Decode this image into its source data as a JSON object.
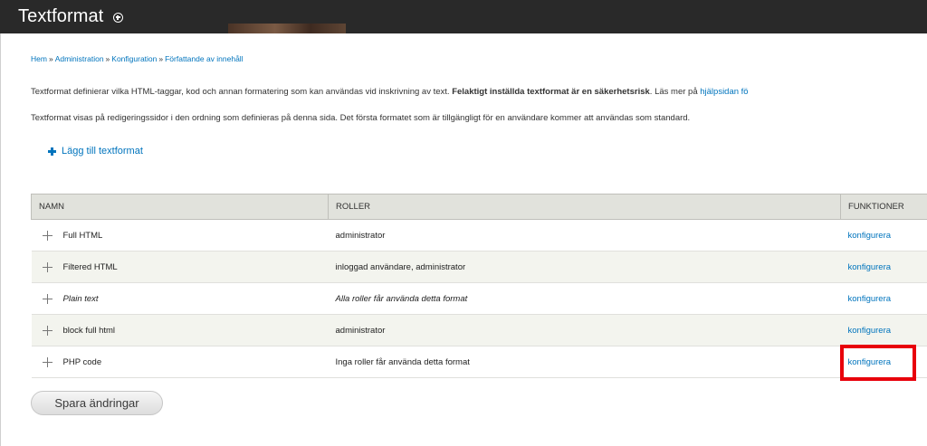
{
  "header": {
    "title": "Textformat",
    "shortcut_icon": "add-shortcut-icon"
  },
  "breadcrumb": {
    "items": [
      "Hem",
      "Administration",
      "Konfiguration",
      "Författande av innehåll"
    ],
    "separator": "»"
  },
  "help": {
    "line1_start": "Textformat definierar vilka HTML-taggar, kod och annan formatering som kan användas vid inskrivning av text. ",
    "line1_bold": "Felaktigt inställda textformat är en säkerhetsrisk",
    "line1_end": ". Läs mer på ",
    "line1_link": "hjälpsidan fö",
    "line2": "Textformat visas på redigeringssidor i den ordning som definieras på denna sida. Det första formatet som är tillgängligt för en användare kommer att användas som standard."
  },
  "add_link": {
    "label": "Lägg till textformat",
    "icon": "plus-icon"
  },
  "table": {
    "headers": [
      "NAMN",
      "ROLLER",
      "FUNKTIONER"
    ],
    "rows": [
      {
        "name": "Full HTML",
        "roles": "administrator",
        "action": "konfigurera",
        "italic": false
      },
      {
        "name": "Filtered HTML",
        "roles": "inloggad användare, administrator",
        "action": "konfigurera",
        "italic": false
      },
      {
        "name": "Plain text",
        "roles": "Alla roller får använda detta format",
        "action": "konfigurera",
        "italic": true
      },
      {
        "name": "block full html",
        "roles": "administrator",
        "action": "konfigurera",
        "italic": false
      },
      {
        "name": "PHP code",
        "roles": "Inga roller får använda detta format",
        "action": "konfigurera",
        "italic": false
      }
    ]
  },
  "save_button": {
    "label": "Spara ändringar"
  },
  "colors": {
    "topbar": "#292929",
    "link": "#0074bd",
    "highlight": "#e8000b",
    "table_header": "#e1e2dc",
    "row_even": "#f3f4ee"
  }
}
